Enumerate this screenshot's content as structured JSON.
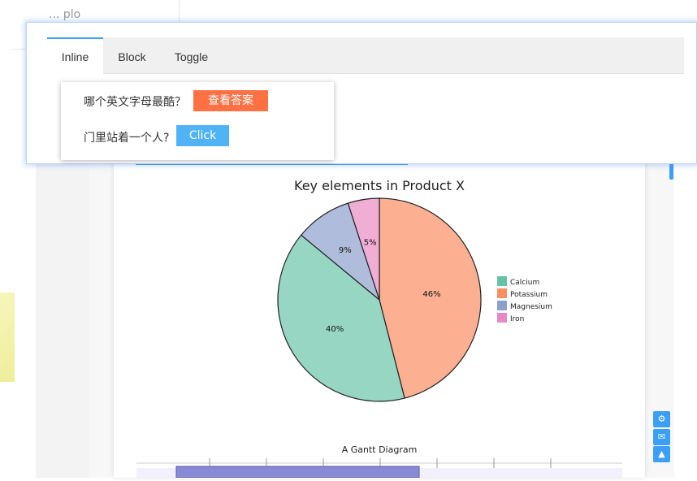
{
  "background": {
    "nav_text": "... plo"
  },
  "tabs": [
    {
      "label": "Inline",
      "active": true
    },
    {
      "label": "Block",
      "active": false
    },
    {
      "label": "Toggle",
      "active": false
    }
  ],
  "popover": {
    "q1": "哪个英文字母最酷？",
    "btn1": "查看答案",
    "btn1_color": "#ff7043",
    "q2": "门里站着一个人?",
    "btn2": "Click",
    "btn2_color": "#4fb3f6"
  },
  "chart_data": {
    "type": "pie",
    "title": "Key elements in Product X",
    "slices": [
      {
        "label": "Calcium",
        "value": 40,
        "display": "40%",
        "color": "#97d6c3"
      },
      {
        "label": "Potassium",
        "value": 46,
        "display": "46%",
        "color": "#fcb091"
      },
      {
        "label": "Magnesium",
        "value": 9,
        "display": "9%",
        "color": "#b0bcdc"
      },
      {
        "label": "Iron",
        "value": 5,
        "display": "5%",
        "color": "#f0aed5"
      }
    ],
    "legend": [
      "Calcium",
      "Potassium",
      "Magnesium",
      "Iron"
    ],
    "legend_colors": [
      "#66c2a5",
      "#fc8d62",
      "#8da0cb",
      "#e78ac3"
    ],
    "legend_position": "right"
  },
  "gantt": {
    "title": "A Gantt Diagram"
  },
  "fabs": [
    {
      "icon": "gear-icon",
      "glyph": "⚙"
    },
    {
      "icon": "chat-icon",
      "glyph": "✉"
    },
    {
      "icon": "arrow-up-icon",
      "glyph": "▲"
    }
  ]
}
